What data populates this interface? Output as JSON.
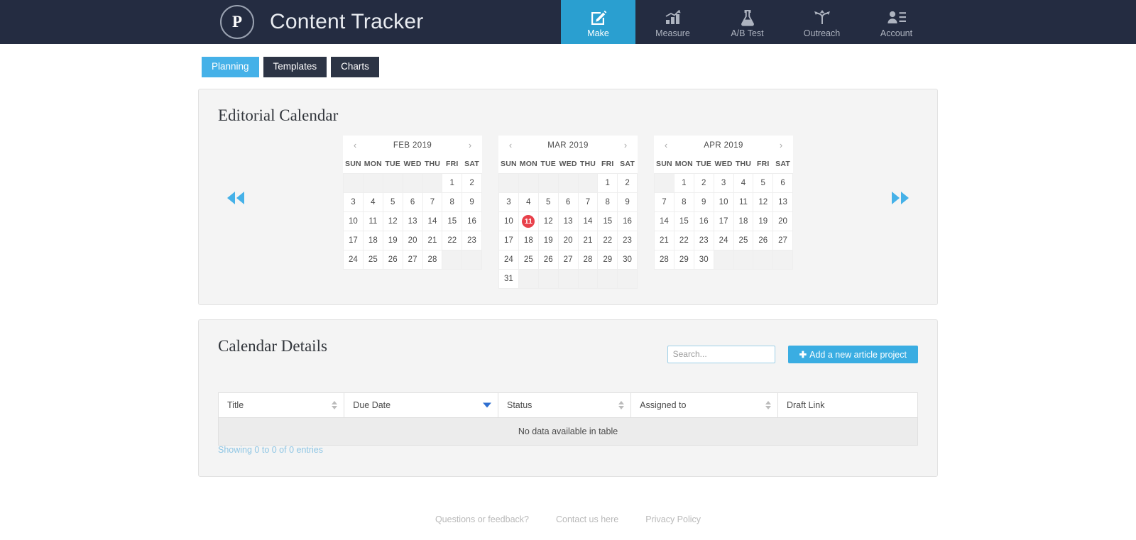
{
  "navbar": {
    "logo_letter": "P",
    "title": "Content Tracker",
    "items": [
      {
        "label": "Make",
        "icon": "pencil-square-icon",
        "active": true
      },
      {
        "label": "Measure",
        "icon": "bar-chart-icon",
        "active": false
      },
      {
        "label": "A/B Test",
        "icon": "flask-icon",
        "active": false
      },
      {
        "label": "Outreach",
        "icon": "share-arrows-icon",
        "active": false
      },
      {
        "label": "Account",
        "icon": "user-list-icon",
        "active": false
      }
    ]
  },
  "tabs": [
    {
      "label": "Planning",
      "active": true
    },
    {
      "label": "Templates",
      "active": false
    },
    {
      "label": "Charts",
      "active": false
    }
  ],
  "editorial_calendar": {
    "title": "Editorial Calendar",
    "prev_all_icon": "fast-backward-icon",
    "next_all_icon": "fast-forward-icon",
    "weekday_headers": [
      "SUN",
      "MON",
      "TUE",
      "WED",
      "THU",
      "FRI",
      "SAT"
    ],
    "prev_arrow": "‹",
    "next_arrow": "›",
    "months": [
      {
        "label": "FEB 2019",
        "lead_blanks": 5,
        "days": 28,
        "today": null
      },
      {
        "label": "MAR 2019",
        "lead_blanks": 5,
        "days": 31,
        "today": 11
      },
      {
        "label": "APR 2019",
        "lead_blanks": 1,
        "days": 30,
        "today": null
      }
    ]
  },
  "calendar_details": {
    "title": "Calendar Details",
    "search_placeholder": "Search...",
    "search_value": "",
    "add_button": "Add a new article project",
    "add_button_icon": "plus-icon",
    "columns": [
      {
        "label": "Title",
        "sort": "none"
      },
      {
        "label": "Due Date",
        "sort": "desc"
      },
      {
        "label": "Status",
        "sort": "none"
      },
      {
        "label": "Assigned to",
        "sort": "none"
      },
      {
        "label": "Draft Link",
        "sort": "none"
      }
    ],
    "empty_message": "No data available in table",
    "showing": "Showing 0 to 0 of 0 entries"
  },
  "footer": {
    "links": [
      "Questions or feedback?",
      "Contact us here",
      "Privacy Policy"
    ]
  },
  "colors": {
    "navbar_bg": "#242c41",
    "accent": "#45b1e8",
    "accent_active_nav": "#2a9fd0",
    "today_badge": "#e8404a",
    "panel_bg": "#f4f4f4",
    "add_button_bg": "#3aade2"
  }
}
